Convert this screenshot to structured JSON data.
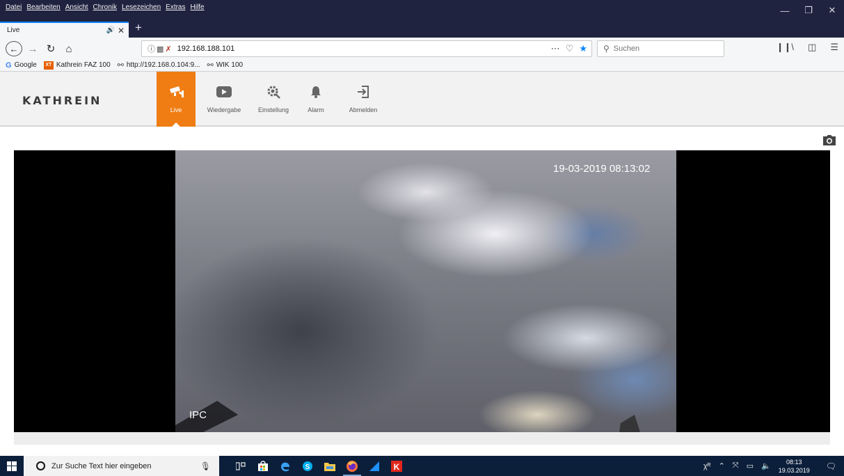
{
  "browser": {
    "menu": [
      "Datei",
      "Bearbeiten",
      "Ansicht",
      "Chronik",
      "Lesezeichen",
      "Extras",
      "Hilfe"
    ],
    "tab_title": "Live",
    "url": "192.168.188.101",
    "search_placeholder": "Suchen",
    "bookmarks": [
      {
        "label": "Google",
        "icon": "google-icon"
      },
      {
        "label": "Kathrein FAZ 100",
        "icon": "xt-icon"
      },
      {
        "label": "http://192.168.0.104:9...",
        "icon": "globe-icon"
      },
      {
        "label": "WIK 100",
        "icon": "globe-icon"
      }
    ],
    "accent_color": "#0a84ff"
  },
  "app": {
    "logo": "KATHREIN",
    "nav": [
      {
        "label": "Live",
        "icon": "security-camera-icon",
        "active": true
      },
      {
        "label": "Wiedergabe",
        "icon": "play-icon",
        "active": false
      },
      {
        "label": "Einstellung",
        "icon": "gear-icon",
        "active": false
      },
      {
        "label": "Alarm",
        "icon": "bell-icon",
        "active": false
      },
      {
        "label": "Abmelden",
        "icon": "logout-icon",
        "active": false
      }
    ],
    "accent_color": "#ef7d14"
  },
  "video": {
    "timestamp": "19-03-2019 08:13:02",
    "channel_label": "IPC"
  },
  "taskbar": {
    "search_placeholder": "Zur Suche Text hier eingeben",
    "clock_time": "08:13",
    "clock_date": "19.03.2019"
  }
}
